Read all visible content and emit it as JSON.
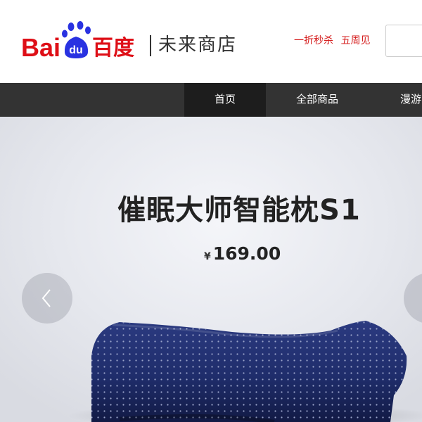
{
  "header": {
    "logo": {
      "text_left": "Bai",
      "text_paw": "du",
      "text_right": "百度",
      "subtitle": "未来商店"
    },
    "promo": {
      "flash_sale": "一折秒杀",
      "anniversary": "五周见"
    }
  },
  "nav": {
    "items": [
      {
        "label": "首页",
        "active": true
      },
      {
        "label": "全部商品",
        "active": false
      },
      {
        "label": "漫游",
        "active": false
      }
    ]
  },
  "banner": {
    "title": "催眠大师智能枕S1",
    "currency_symbol": "¥",
    "price": "169.00",
    "prev_icon": "chevron-left-icon",
    "next_icon": "chevron-right-icon"
  },
  "colors": {
    "brand_red": "#de0f17",
    "brand_blue": "#2932e1",
    "promo_red": "#d51e1e",
    "nav_bg": "#333333",
    "nav_active_bg": "#1d1d1d",
    "pillow_navy": "#1f2d6b"
  }
}
